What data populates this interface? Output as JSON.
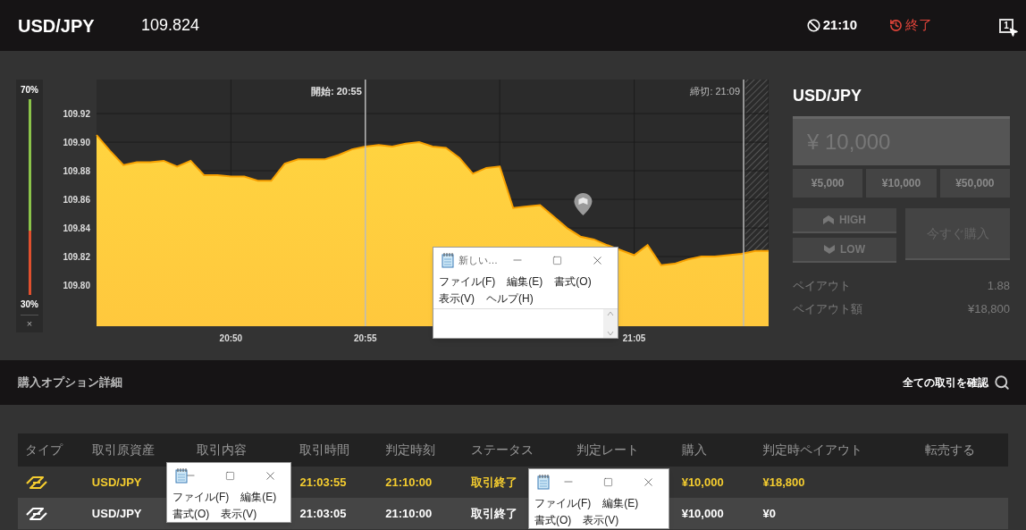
{
  "header": {
    "symbol": "USD/JPY",
    "price": "109.824",
    "deadline": "21:10",
    "status": "終了",
    "screen_badge": "1"
  },
  "meter": {
    "top_label": "70%",
    "bottom_label": "30%",
    "level": 0.67,
    "close": "×"
  },
  "chart": {
    "chart_data": {
      "type": "area",
      "grid": true,
      "ylim": [
        109.7713,
        109.9438
      ],
      "yticks": [
        {
          "value": 109.8,
          "label": "109.80"
        },
        {
          "value": 109.82,
          "label": "109.82"
        },
        {
          "value": 109.84,
          "label": "109.84"
        },
        {
          "value": 109.86,
          "label": "109.86"
        },
        {
          "value": 109.88,
          "label": "109.88"
        },
        {
          "value": 109.9,
          "label": "109.90"
        },
        {
          "value": 109.92,
          "label": "109.92"
        }
      ],
      "categories": [
        null,
        null,
        null,
        null,
        null,
        null,
        null,
        null,
        null,
        null,
        "20:50",
        null,
        null,
        null,
        null,
        null,
        null,
        null,
        null,
        null,
        "20:55",
        null,
        null,
        null,
        null,
        null,
        null,
        null,
        null,
        null,
        null,
        null,
        null,
        null,
        null,
        null,
        null,
        null,
        null,
        null,
        "21:05",
        null,
        null,
        null,
        null,
        null,
        null,
        null,
        null,
        null,
        null
      ],
      "series": [
        {
          "color": "#ffc83d",
          "values": [
            109.905,
            109.894,
            109.884,
            109.886,
            109.886,
            109.887,
            109.883,
            109.887,
            109.877,
            109.877,
            109.876,
            109.876,
            109.873,
            109.873,
            109.885,
            109.888,
            109.888,
            109.888,
            109.891,
            109.895,
            109.897,
            109.898,
            109.897,
            109.899,
            109.9,
            109.897,
            109.896,
            109.889,
            109.878,
            109.882,
            109.883,
            109.854,
            109.855,
            109.856,
            109.848,
            109.84,
            109.834,
            109.832,
            109.828,
            null,
            109.821,
            109.828,
            109.814,
            109.815,
            109.818,
            109.82,
            109.82,
            109.821,
            109.822,
            109.824,
            109.824
          ]
        }
      ],
      "annotations": [
        "開始: 20:55",
        "締切: 21:09"
      ]
    }
  },
  "order_panel": {
    "symbol": "USD/JPY",
    "amount": "¥ 10,000",
    "presets": [
      "¥5,000",
      "¥10,000",
      "¥50,000"
    ],
    "high": "HIGH",
    "low": "LOW",
    "buy": {
      "label": "今すぐ購入",
      "disabled": true
    },
    "payout": [
      {
        "label": "ペイアウト",
        "value": "1.88"
      },
      {
        "label": "ペイアウト額",
        "value": "¥18,800"
      }
    ]
  },
  "details_bar": {
    "title": "購入オプション詳細",
    "link": "全ての取引を確認"
  },
  "table": {
    "columns": [
      "タイプ",
      "取引原資産",
      "取引内容",
      "取引時間",
      "判定時刻",
      "ステータス",
      "判定レート",
      "購入",
      "判定時ペイアウト",
      "転売する"
    ],
    "rows": [
      {
        "color": "#f5cd2f",
        "asset": "USD/JPY",
        "trade_time": "21:03:55",
        "judge_time": "21:10:00",
        "status": "取引終了",
        "purchase": "¥10,000",
        "payout": "¥18,800"
      },
      {
        "color": "#ffffff",
        "asset": "USD/JPY",
        "trade_time": "21:03:05",
        "judge_time": "21:10:00",
        "status": "取引終了",
        "purchase": "¥10,000",
        "payout": "¥0"
      }
    ]
  },
  "windows": [
    {
      "title": "新しい…",
      "menu_rows": [
        [
          "ファイル(F)",
          "編集(E)",
          "書式(O)"
        ],
        [
          "表示(V)",
          "ヘルプ(H)"
        ]
      ],
      "edit_area": true
    },
    {
      "menu_rows": [
        [
          "ファイル(F)",
          "編集(E)"
        ],
        [
          "書式(O)",
          "表示(V)"
        ]
      ]
    },
    {
      "menu_rows": [
        [
          "ファイル(F)",
          "編集(E)"
        ],
        [
          "書式(O)",
          "表示(V)"
        ]
      ]
    }
  ]
}
